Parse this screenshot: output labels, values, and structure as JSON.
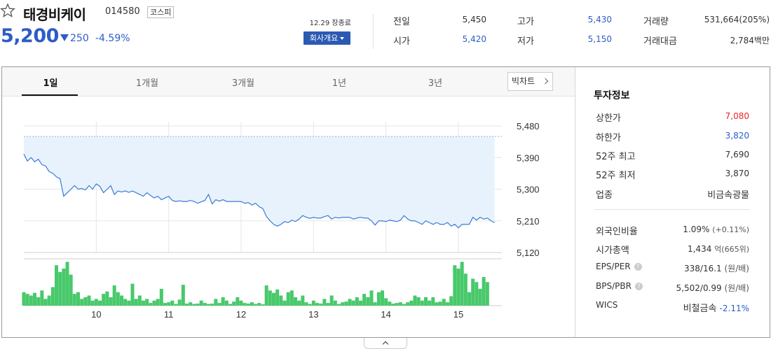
{
  "stock": {
    "name": "태경비케이",
    "code": "014580",
    "market": "코스피",
    "price": "5,200",
    "change": "250",
    "change_pct": "-4.59%",
    "status": "12.29 장종료",
    "overview_label": "회사개요"
  },
  "summary": {
    "prev_close_label": "전일",
    "prev_close": "5,450",
    "open_label": "시가",
    "open": "5,420",
    "high_label": "고가",
    "high": "5,430",
    "low_label": "저가",
    "low": "5,150",
    "volume_label": "거래량",
    "volume": "531,664(205%)",
    "amount_label": "거래대금",
    "amount": "2,784백만"
  },
  "tabs": [
    {
      "label": "1일",
      "active": true
    },
    {
      "label": "1개월",
      "active": false
    },
    {
      "label": "3개월",
      "active": false
    },
    {
      "label": "1년",
      "active": false
    },
    {
      "label": "3년",
      "active": false
    }
  ],
  "big_chart_label": "빅차트",
  "invest_info": {
    "title": "투자정보",
    "rows1": [
      {
        "label": "상한가",
        "value": "7,080",
        "color": "#e22222"
      },
      {
        "label": "하한가",
        "value": "3,820",
        "color": "#2d5cc8"
      },
      {
        "label": "52주 최고",
        "value": "7,690",
        "color": "#333333"
      },
      {
        "label": "52주 최저",
        "value": "3,870",
        "color": "#333333"
      },
      {
        "label": "업종",
        "value": "비금속광물",
        "color": "#333333"
      }
    ],
    "foreign_label": "외국인비율",
    "foreign_value": "1.09%",
    "foreign_change": "(+0.11%)",
    "mcap_label": "시가총액",
    "mcap_value": "1,434",
    "mcap_unit": "억(665위)",
    "eps_label": "EPS/PER",
    "eps_value": "338/16.1",
    "eps_unit": "(원/배)",
    "bps_label": "BPS/PBR",
    "bps_value": "5,502/0.99",
    "bps_unit": "(원/배)",
    "wics_label": "WICS",
    "wics_value": "비철금속",
    "wics_change": "-2.11%"
  },
  "chart_data": {
    "type": "line",
    "title": "",
    "y_ticks": [
      "5,480",
      "5,390",
      "5,300",
      "5,210",
      "5,120"
    ],
    "y_tick_values": [
      5480,
      5390,
      5300,
      5210,
      5120
    ],
    "ylim": [
      5120,
      5480
    ],
    "reference_value": 5450,
    "x_ticks": [
      "10",
      "11",
      "12",
      "13",
      "14",
      "15"
    ],
    "x_tick_positions": [
      10,
      11,
      12,
      13,
      14,
      15
    ],
    "xlim": [
      9.0,
      15.6
    ],
    "grid": true,
    "price_series": [
      [
        9.0,
        5400
      ],
      [
        9.05,
        5380
      ],
      [
        9.1,
        5390
      ],
      [
        9.15,
        5378
      ],
      [
        9.2,
        5385
      ],
      [
        9.25,
        5370
      ],
      [
        9.3,
        5366
      ],
      [
        9.35,
        5350
      ],
      [
        9.4,
        5345
      ],
      [
        9.45,
        5335
      ],
      [
        9.5,
        5330
      ],
      [
        9.55,
        5280
      ],
      [
        9.6,
        5290
      ],
      [
        9.65,
        5300
      ],
      [
        9.7,
        5310
      ],
      [
        9.75,
        5300
      ],
      [
        9.8,
        5302
      ],
      [
        9.85,
        5298
      ],
      [
        9.9,
        5310
      ],
      [
        9.95,
        5300
      ],
      [
        10.0,
        5315
      ],
      [
        10.05,
        5308
      ],
      [
        10.1,
        5290
      ],
      [
        10.15,
        5300
      ],
      [
        10.2,
        5310
      ],
      [
        10.25,
        5285
      ],
      [
        10.3,
        5295
      ],
      [
        10.35,
        5292
      ],
      [
        10.4,
        5295
      ],
      [
        10.45,
        5291
      ],
      [
        10.5,
        5295
      ],
      [
        10.55,
        5290
      ],
      [
        10.6,
        5285
      ],
      [
        10.65,
        5280
      ],
      [
        10.7,
        5290
      ],
      [
        10.75,
        5282
      ],
      [
        10.8,
        5275
      ],
      [
        10.85,
        5280
      ],
      [
        10.9,
        5270
      ],
      [
        10.95,
        5275
      ],
      [
        11.0,
        5280
      ],
      [
        11.05,
        5268
      ],
      [
        11.1,
        5265
      ],
      [
        11.15,
        5267
      ],
      [
        11.2,
        5265
      ],
      [
        11.25,
        5265
      ],
      [
        11.3,
        5268
      ],
      [
        11.35,
        5265
      ],
      [
        11.4,
        5260
      ],
      [
        11.45,
        5264
      ],
      [
        11.5,
        5268
      ],
      [
        11.55,
        5285
      ],
      [
        11.6,
        5258
      ],
      [
        11.65,
        5270
      ],
      [
        11.7,
        5266
      ],
      [
        11.75,
        5270
      ],
      [
        11.8,
        5265
      ],
      [
        11.85,
        5265
      ],
      [
        11.9,
        5265
      ],
      [
        11.95,
        5265
      ],
      [
        12.0,
        5265
      ],
      [
        12.05,
        5260
      ],
      [
        12.1,
        5262
      ],
      [
        12.15,
        5255
      ],
      [
        12.2,
        5260
      ],
      [
        12.25,
        5250
      ],
      [
        12.3,
        5245
      ],
      [
        12.35,
        5222
      ],
      [
        12.4,
        5210
      ],
      [
        12.45,
        5200
      ],
      [
        12.5,
        5195
      ],
      [
        12.55,
        5200
      ],
      [
        12.6,
        5208
      ],
      [
        12.65,
        5205
      ],
      [
        12.7,
        5212
      ],
      [
        12.75,
        5208
      ],
      [
        12.8,
        5215
      ],
      [
        12.85,
        5225
      ],
      [
        12.9,
        5220
      ],
      [
        12.95,
        5217
      ],
      [
        13.0,
        5220
      ],
      [
        13.05,
        5218
      ],
      [
        13.1,
        5218
      ],
      [
        13.15,
        5222
      ],
      [
        13.2,
        5225
      ],
      [
        13.25,
        5215
      ],
      [
        13.3,
        5220
      ],
      [
        13.35,
        5218
      ],
      [
        13.4,
        5220
      ],
      [
        13.45,
        5220
      ],
      [
        13.5,
        5220
      ],
      [
        13.55,
        5215
      ],
      [
        13.6,
        5218
      ],
      [
        13.65,
        5220
      ],
      [
        13.7,
        5218
      ],
      [
        13.75,
        5218
      ],
      [
        13.8,
        5210
      ],
      [
        13.85,
        5198
      ],
      [
        13.9,
        5210
      ],
      [
        13.95,
        5210
      ],
      [
        14.0,
        5208
      ],
      [
        14.05,
        5212
      ],
      [
        14.1,
        5210
      ],
      [
        14.15,
        5208
      ],
      [
        14.2,
        5212
      ],
      [
        14.25,
        5225
      ],
      [
        14.3,
        5215
      ],
      [
        14.35,
        5210
      ],
      [
        14.4,
        5210
      ],
      [
        14.45,
        5205
      ],
      [
        14.5,
        5200
      ],
      [
        14.55,
        5210
      ],
      [
        14.6,
        5205
      ],
      [
        14.65,
        5200
      ],
      [
        14.7,
        5205
      ],
      [
        14.75,
        5200
      ],
      [
        14.8,
        5200
      ],
      [
        14.85,
        5205
      ],
      [
        14.9,
        5195
      ],
      [
        14.95,
        5200
      ],
      [
        15.0,
        5190
      ],
      [
        15.05,
        5200
      ],
      [
        15.1,
        5200
      ],
      [
        15.15,
        5200
      ],
      [
        15.2,
        5220
      ],
      [
        15.25,
        5212
      ],
      [
        15.3,
        5220
      ],
      [
        15.35,
        5215
      ],
      [
        15.4,
        5218
      ],
      [
        15.45,
        5210
      ],
      [
        15.5,
        5205
      ]
    ],
    "volume_series": [
      [
        9.0,
        40
      ],
      [
        9.05,
        35
      ],
      [
        9.1,
        30
      ],
      [
        9.15,
        38
      ],
      [
        9.2,
        25
      ],
      [
        9.25,
        45
      ],
      [
        9.3,
        20
      ],
      [
        9.35,
        30
      ],
      [
        9.4,
        55
      ],
      [
        9.45,
        120
      ],
      [
        9.5,
        100
      ],
      [
        9.55,
        110
      ],
      [
        9.6,
        130
      ],
      [
        9.65,
        92
      ],
      [
        9.7,
        35
      ],
      [
        9.75,
        40
      ],
      [
        9.8,
        20
      ],
      [
        9.85,
        25
      ],
      [
        9.9,
        30
      ],
      [
        9.95,
        15
      ],
      [
        10.0,
        20
      ],
      [
        10.05,
        15
      ],
      [
        10.1,
        35
      ],
      [
        10.15,
        42
      ],
      [
        10.2,
        25
      ],
      [
        10.25,
        60
      ],
      [
        10.3,
        40
      ],
      [
        10.35,
        30
      ],
      [
        10.4,
        20
      ],
      [
        10.45,
        15
      ],
      [
        10.5,
        65
      ],
      [
        10.55,
        20
      ],
      [
        10.6,
        30
      ],
      [
        10.65,
        15
      ],
      [
        10.7,
        20
      ],
      [
        10.75,
        8
      ],
      [
        10.8,
        15
      ],
      [
        10.85,
        20
      ],
      [
        10.9,
        50
      ],
      [
        10.95,
        8
      ],
      [
        11.0,
        10
      ],
      [
        11.05,
        15
      ],
      [
        11.1,
        5
      ],
      [
        11.15,
        18
      ],
      [
        11.2,
        62
      ],
      [
        11.25,
        6
      ],
      [
        11.3,
        10
      ],
      [
        11.35,
        5
      ],
      [
        11.4,
        6
      ],
      [
        11.45,
        15
      ],
      [
        11.5,
        8
      ],
      [
        11.55,
        5
      ],
      [
        11.6,
        6
      ],
      [
        11.65,
        20
      ],
      [
        11.7,
        8
      ],
      [
        11.75,
        25
      ],
      [
        11.8,
        15
      ],
      [
        11.85,
        5
      ],
      [
        11.9,
        12
      ],
      [
        11.95,
        25
      ],
      [
        12.0,
        15
      ],
      [
        12.05,
        8
      ],
      [
        12.1,
        6
      ],
      [
        12.15,
        10
      ],
      [
        12.2,
        5
      ],
      [
        12.25,
        8
      ],
      [
        12.3,
        4
      ],
      [
        12.35,
        60
      ],
      [
        12.4,
        45
      ],
      [
        12.45,
        38
      ],
      [
        12.5,
        48
      ],
      [
        12.55,
        30
      ],
      [
        12.6,
        15
      ],
      [
        12.65,
        40
      ],
      [
        12.7,
        45
      ],
      [
        12.75,
        25
      ],
      [
        12.8,
        15
      ],
      [
        12.85,
        30
      ],
      [
        12.9,
        10
      ],
      [
        12.95,
        5
      ],
      [
        13.0,
        15
      ],
      [
        13.05,
        8
      ],
      [
        13.1,
        6
      ],
      [
        13.15,
        20
      ],
      [
        13.2,
        8
      ],
      [
        13.25,
        30
      ],
      [
        13.3,
        15
      ],
      [
        13.35,
        5
      ],
      [
        13.4,
        10
      ],
      [
        13.45,
        12
      ],
      [
        13.5,
        20
      ],
      [
        13.55,
        15
      ],
      [
        13.6,
        25
      ],
      [
        13.65,
        15
      ],
      [
        13.7,
        35
      ],
      [
        13.75,
        25
      ],
      [
        13.8,
        45
      ],
      [
        13.85,
        10
      ],
      [
        13.9,
        40
      ],
      [
        13.95,
        45
      ],
      [
        14.0,
        22
      ],
      [
        14.05,
        12
      ],
      [
        14.1,
        6
      ],
      [
        14.15,
        8
      ],
      [
        14.2,
        10
      ],
      [
        14.25,
        5
      ],
      [
        14.3,
        10
      ],
      [
        14.35,
        15
      ],
      [
        14.4,
        30
      ],
      [
        14.45,
        25
      ],
      [
        14.5,
        15
      ],
      [
        14.55,
        25
      ],
      [
        14.6,
        15
      ],
      [
        14.65,
        25
      ],
      [
        14.7,
        10
      ],
      [
        14.75,
        12
      ],
      [
        14.8,
        20
      ],
      [
        14.85,
        10
      ],
      [
        14.9,
        28
      ],
      [
        14.95,
        120
      ],
      [
        15.0,
        110
      ],
      [
        15.05,
        130
      ],
      [
        15.1,
        95
      ],
      [
        15.15,
        40
      ],
      [
        15.2,
        80
      ],
      [
        15.25,
        70
      ],
      [
        15.3,
        50
      ],
      [
        15.35,
        85
      ],
      [
        15.4,
        70
      ]
    ],
    "volume_ylim": [
      0,
      135
    ]
  }
}
